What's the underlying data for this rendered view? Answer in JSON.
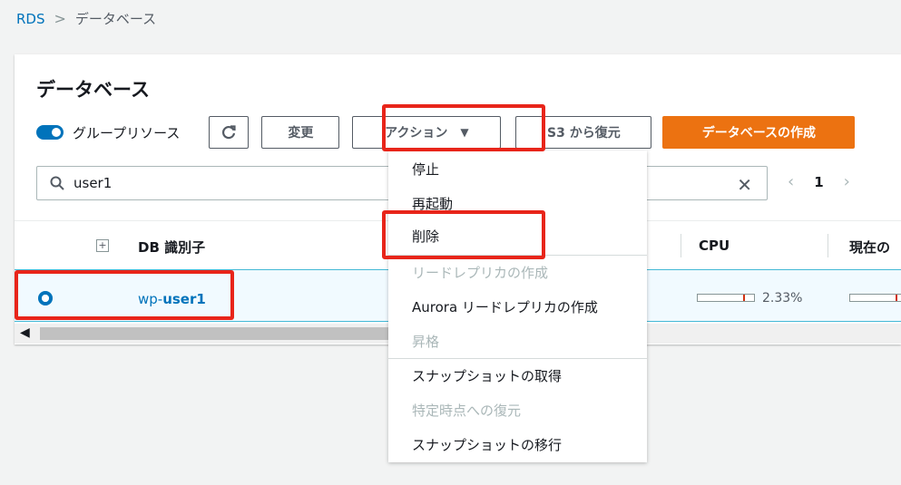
{
  "breadcrumb": {
    "root": "RDS",
    "separator": ">",
    "current": "データベース"
  },
  "panel": {
    "title": "データベース"
  },
  "toolbar": {
    "group_toggle_label": "グループリソース",
    "refresh_icon": "refresh-icon",
    "modify_label": "変更",
    "actions_label": "アクション",
    "actions_caret": "▼",
    "restore_s3_label": "S3 から復元",
    "create_label": "データベースの作成"
  },
  "search": {
    "value": "user1",
    "clear_icon": "✕"
  },
  "pagination": {
    "prev": "‹",
    "page": "1",
    "next": "›"
  },
  "table": {
    "columns": {
      "db_id": "DB 識別子",
      "cpu": "CPU",
      "current": "現在の"
    },
    "rows": [
      {
        "db_id_prefix": "wp-",
        "db_id_match": "user1",
        "cpu": "2.33%",
        "cpu_fraction": 0.0233
      }
    ]
  },
  "actions_menu": {
    "items": [
      {
        "label": "停止",
        "enabled": true
      },
      {
        "label": "再起動",
        "enabled": true
      },
      {
        "label": "削除",
        "enabled": true
      },
      {
        "label": "リードレプリカの作成",
        "enabled": false
      },
      {
        "label": "Aurora リードレプリカの作成",
        "enabled": true
      },
      {
        "label": "昇格",
        "enabled": false
      },
      {
        "label": "スナップショットの取得",
        "enabled": true
      },
      {
        "label": "特定時点への復元",
        "enabled": false
      },
      {
        "label": "スナップショットの移行",
        "enabled": true
      }
    ]
  },
  "colors": {
    "accent": "#0073bb",
    "primary_button": "#ec7211",
    "highlight": "#e8251a"
  }
}
